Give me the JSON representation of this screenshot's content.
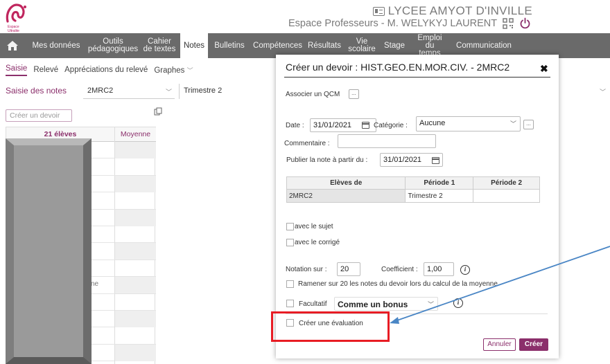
{
  "header": {
    "logo_text": "Espace Ultralite",
    "school_name": "LYCEE AMYOT D'INVILLE",
    "space_label": "Espace Professeurs - M. WELYKYJ LAURENT"
  },
  "nav": {
    "items": [
      {
        "label": "Mes données"
      },
      {
        "label": "Outils pédagogiques"
      },
      {
        "label": "Cahier de textes"
      },
      {
        "label": "Notes"
      },
      {
        "label": "Bulletins"
      },
      {
        "label": "Compétences"
      },
      {
        "label": "Résultats"
      },
      {
        "label": "Vie scolaire"
      },
      {
        "label": "Stage"
      },
      {
        "label": "Emploi du temps"
      },
      {
        "label": "Communication"
      }
    ],
    "active": "Notes"
  },
  "subnav": {
    "items": [
      "Saisie",
      "Relevé",
      "Appréciations du relevé",
      "Graphes"
    ]
  },
  "filters": {
    "title": "Saisie des notes",
    "class_value": "2MRC2",
    "period_value": "Trimestre 2"
  },
  "grid": {
    "create_placeholder": "Créer un devoir",
    "col_students": "21 élèves",
    "col_average": "Moyenne",
    "row_fragment": "ne"
  },
  "modal": {
    "title": "Créer un devoir : HIST.GEO.EN.MOR.CIV. - 2MRC2",
    "close": "✖",
    "qcm_label": "Associer un QCM",
    "more": "...",
    "date_label": "Date :",
    "date_value": "31/01/2021",
    "category_label": "Catégorie :",
    "category_value": "Aucune",
    "comment_label": "Commentaire :",
    "comment_value": "",
    "publish_label": "Publier la note à partir du :",
    "publish_value": "31/01/2021",
    "table": {
      "headers": [
        "Elèves de",
        "Période 1",
        "Période 2"
      ],
      "rows": [
        [
          "2MRC2",
          "Trimestre 2",
          ""
        ]
      ]
    },
    "with_subject": "avec le sujet",
    "with_correction": "avec le corrigé",
    "notation_label": "Notation sur :",
    "notation_value": "20",
    "coef_label": "Coefficient :",
    "coef_value": "1,00",
    "bring_back": "Ramener sur 20 les notes du devoir lors du calcul de la moyenne",
    "optional_label": "Facultatif",
    "optional_value": "Comme un bonus",
    "create_eval": "Créer une évaluation",
    "cancel": "Annuler",
    "create": "Créer"
  },
  "colors": {
    "accent": "#8b2f6b",
    "nav_bg": "#6a6a6a",
    "highlight": "#e81c24",
    "arrow": "#4a86c5"
  }
}
